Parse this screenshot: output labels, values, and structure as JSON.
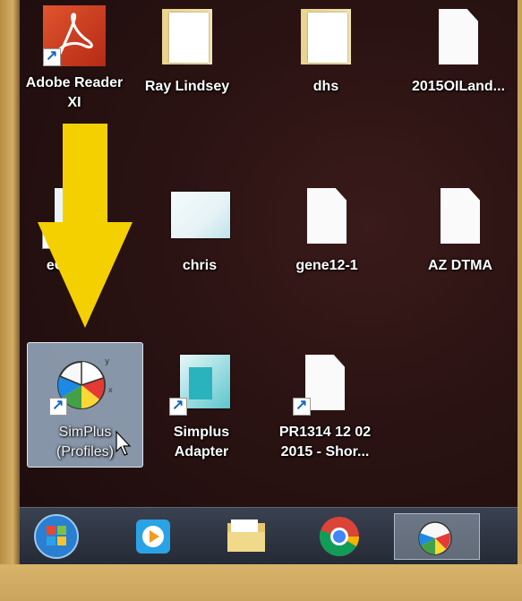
{
  "desktop": {
    "icons": [
      {
        "label": "Adobe Reader\nXI"
      },
      {
        "label": "Ray Lindsey"
      },
      {
        "label": "dhs"
      },
      {
        "label": "2015OILand..."
      },
      {
        "label": "eG...sch"
      },
      {
        "label": "chris"
      },
      {
        "label": "gene12-1"
      },
      {
        "label": "AZ DTMA"
      },
      {
        "label": "SimPlus\n(Profiles)"
      },
      {
        "label": "Simplus\nAdapter"
      },
      {
        "label": "PR1314 12 02\n2015 - Shor..."
      }
    ]
  },
  "taskbar": {
    "items": [
      "start-orb",
      "media-player",
      "file-explorer",
      "chrome",
      "simplus-profiles"
    ]
  },
  "colors": {
    "arrow": "#f5d000",
    "selection": "#aac3dc",
    "desktop": "#2a1212"
  }
}
